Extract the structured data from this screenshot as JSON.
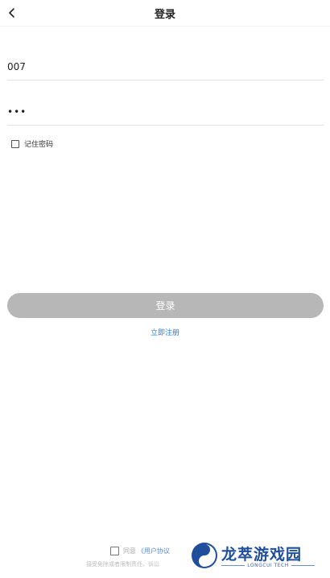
{
  "header": {
    "title": "登录",
    "back_icon": "chevron-left-icon"
  },
  "form": {
    "account_value": "007",
    "password_value": "•••",
    "remember_label": "记住密码",
    "remember_checked": false
  },
  "actions": {
    "login_label": "登录",
    "register_label": "立即注册"
  },
  "agreement": {
    "prefix": "同意",
    "link_label": "《用户协议",
    "fine_print": "接受免除或者限制责任、诉讼",
    "checked": false
  },
  "watermark": {
    "title": "龙萃游戏园",
    "subtitle": "LONGCUI TECH"
  },
  "colors": {
    "login_button_bg": "#b7b7b7",
    "link": "#2a7de1",
    "watermark": "#1f4e9c"
  }
}
